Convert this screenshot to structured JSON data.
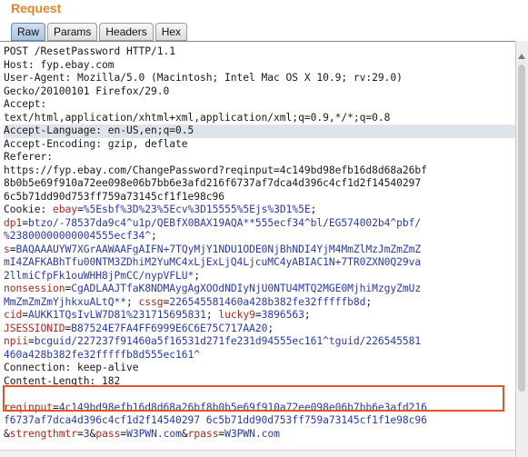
{
  "panel": {
    "title": "Request"
  },
  "tabs": [
    {
      "label": "Raw",
      "active": true
    },
    {
      "label": "Params",
      "active": false
    },
    {
      "label": "Headers",
      "active": false
    },
    {
      "label": "Hex",
      "active": false
    }
  ],
  "colors": {
    "title": "#e8832a",
    "param_name": "#b0241b",
    "param_value": "#2a38b8",
    "highlight_border": "#e85325",
    "cursor_line": "#dfe4ec"
  },
  "request_lines": [
    {
      "segments": [
        {
          "text": "POST /ResetPassword HTTP/1.1",
          "color": "black"
        }
      ]
    },
    {
      "segments": [
        {
          "text": "Host: fyp.ebay.com",
          "color": "black"
        }
      ]
    },
    {
      "segments": [
        {
          "text": "User-Agent: Mozilla/5.0 (Macintosh; Intel Mac OS X 10.9; rv:29.0)",
          "color": "black"
        }
      ]
    },
    {
      "segments": [
        {
          "text": "Gecko/20100101 Firefox/29.0",
          "color": "black"
        }
      ]
    },
    {
      "segments": [
        {
          "text": "Accept:",
          "color": "black"
        }
      ]
    },
    {
      "segments": [
        {
          "text": "text/html,application/xhtml+xml,application/xml;q=0.9,*/*;q=0.8",
          "color": "black"
        }
      ]
    },
    {
      "highlight": true,
      "segments": [
        {
          "text": "Accept-Language: en-US,en;q=0.5",
          "color": "black"
        }
      ]
    },
    {
      "segments": [
        {
          "text": "Accept-Encoding: gzip, deflate",
          "color": "black"
        }
      ]
    },
    {
      "segments": [
        {
          "text": "Referer:",
          "color": "black"
        }
      ]
    },
    {
      "segments": [
        {
          "text": "https://fyp.ebay.com/ChangePassword?reqinput=4c149bd98efb16d8d68a26bf",
          "color": "black"
        }
      ]
    },
    {
      "segments": [
        {
          "text": "8b0b5e69f910a72ee098e06b7bb6e3afd216f6737af7dca4d396c4cf1d2f14540297",
          "color": "black"
        }
      ]
    },
    {
      "segments": [
        {
          "text": "6c5b71dd90d753ff759a73145cf1f1e98c96",
          "color": "black"
        }
      ]
    },
    {
      "segments": [
        {
          "text": "Cookie: ",
          "color": "black"
        },
        {
          "text": "ebay",
          "color": "red"
        },
        {
          "text": "=",
          "color": "black"
        },
        {
          "text": "%5Esbf%3D%23%5Ecv%3D15555%5Ejs%3D1%5E",
          "color": "blue"
        },
        {
          "text": ";",
          "color": "black"
        }
      ]
    },
    {
      "segments": [
        {
          "text": "dp1",
          "color": "red"
        },
        {
          "text": "=",
          "color": "black"
        },
        {
          "text": "btzo/-78537da9c4^u1p/QEBfX0BAX19AQA**555ecf34^bl/EG574002b4^pbf/",
          "color": "blue"
        }
      ]
    },
    {
      "segments": [
        {
          "text": "%23800000000004555ecf34^",
          "color": "blue"
        },
        {
          "text": ";",
          "color": "black"
        }
      ]
    },
    {
      "segments": [
        {
          "text": "s",
          "color": "red"
        },
        {
          "text": "=",
          "color": "black"
        },
        {
          "text": "BAQAAAUYW7XGrAAWAAFgAIFN+7TQyMjY1NDU1ODE0NjBhNDI4YjM4MmZlMzJmZmZmZ",
          "color": "blue"
        }
      ]
    },
    {
      "segments": [
        {
          "text": "mI4ZAFKABhTfu00NTM3ZDhiM2YuMC4xLjExLjQ4LjcuMC4yABIAC1N+7TR0ZXN0Q29va",
          "color": "blue"
        }
      ]
    },
    {
      "segments": [
        {
          "text": "2llmiCfpFk1ouWHH8jPmCC/nypVFLU*",
          "color": "blue"
        },
        {
          "text": ";",
          "color": "black"
        }
      ]
    },
    {
      "segments": [
        {
          "text": "nonsession",
          "color": "red"
        },
        {
          "text": "=",
          "color": "black"
        },
        {
          "text": "CgADLAAJTfaK8NDMAygAgXOOdNDIyNjU0NTU4MTQ2MGE0MjhiMzgyZmUz",
          "color": "blue"
        }
      ]
    },
    {
      "segments": [
        {
          "text": "MmZmZmZmYjhkxuALtQ**",
          "color": "blue"
        },
        {
          "text": "; ",
          "color": "black"
        },
        {
          "text": "cssg",
          "color": "red"
        },
        {
          "text": "=",
          "color": "black"
        },
        {
          "text": "226545581460a428b382fe32fffffb8d",
          "color": "blue"
        },
        {
          "text": ";",
          "color": "black"
        }
      ]
    },
    {
      "segments": [
        {
          "text": "cid",
          "color": "red"
        },
        {
          "text": "=",
          "color": "black"
        },
        {
          "text": "AUKK1TQsIvLW7D81%231715695831",
          "color": "blue"
        },
        {
          "text": "; ",
          "color": "black"
        },
        {
          "text": "lucky9",
          "color": "red"
        },
        {
          "text": "=",
          "color": "black"
        },
        {
          "text": "3896563",
          "color": "blue"
        },
        {
          "text": ";",
          "color": "black"
        }
      ]
    },
    {
      "segments": [
        {
          "text": "JSESSIONID",
          "color": "red"
        },
        {
          "text": "=",
          "color": "black"
        },
        {
          "text": "B87524E7FA4FF6999E6C6E75C717AA20",
          "color": "blue"
        },
        {
          "text": ";",
          "color": "black"
        }
      ]
    },
    {
      "segments": [
        {
          "text": "npii",
          "color": "red"
        },
        {
          "text": "=",
          "color": "black"
        },
        {
          "text": "bcguid/227237f91460a5f16531d271fe231d94555ec161^tguid/226545581",
          "color": "blue"
        }
      ]
    },
    {
      "segments": [
        {
          "text": "460a428b382fe32fffffb8d555ec161^",
          "color": "blue"
        }
      ]
    },
    {
      "segments": [
        {
          "text": "Connection: keep-alive",
          "color": "black"
        }
      ]
    },
    {
      "segments": [
        {
          "text": "Content-Length: 182",
          "color": "black"
        }
      ]
    },
    {
      "segments": [
        {
          "text": "",
          "color": "black"
        }
      ]
    },
    {
      "segments": [
        {
          "text": "reqinput",
          "color": "red"
        },
        {
          "text": "=",
          "color": "black"
        },
        {
          "text": "4c149bd98efb16d8d68a26bf8b0b5e69f910a72ee098e06b7bb6e3afd216",
          "color": "blue"
        }
      ]
    },
    {
      "segments": [
        {
          "text": "f6737af7dca4d396c4cf1d2f14540297 6c5b71dd90d753ff759a73145cf1f1e98c96",
          "color": "blue"
        }
      ]
    },
    {
      "segments": [
        {
          "text": "&",
          "color": "black"
        },
        {
          "text": "strengthmtr",
          "color": "red"
        },
        {
          "text": "=",
          "color": "black"
        },
        {
          "text": "3",
          "color": "blue"
        },
        {
          "text": "&",
          "color": "black"
        },
        {
          "text": "pass",
          "color": "red"
        },
        {
          "text": "=",
          "color": "black"
        },
        {
          "text": "W3PWN.com",
          "color": "blue"
        },
        {
          "text": "&",
          "color": "black"
        },
        {
          "text": "rpass",
          "color": "red"
        },
        {
          "text": "=",
          "color": "black"
        },
        {
          "text": "W3PWN.com",
          "color": "blue"
        }
      ]
    }
  ]
}
